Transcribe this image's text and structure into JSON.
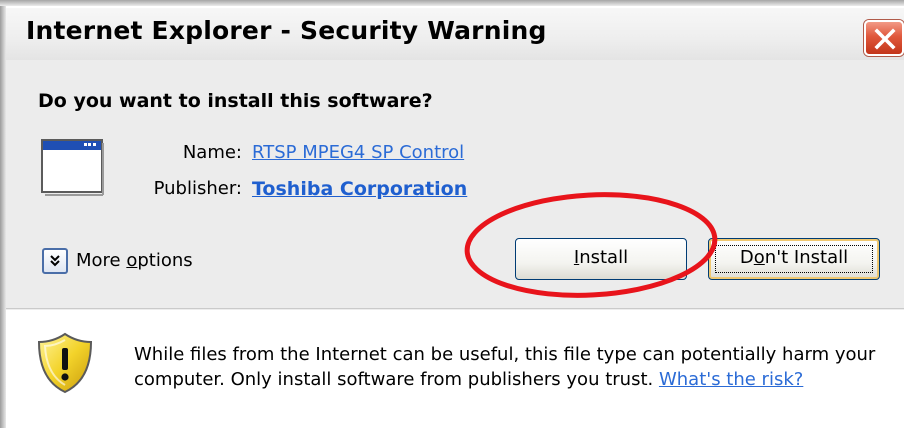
{
  "window": {
    "title": "Internet Explorer - Security Warning",
    "close_icon": "close-x-icon"
  },
  "prompt": {
    "question": "Do you want to install this software?",
    "app_icon": "application-window-icon",
    "name_label": "Name:",
    "name_value": "RTSP MPEG4 SP Control",
    "publisher_label": "Publisher:",
    "publisher_value": "Toshiba Corporation"
  },
  "options": {
    "more_options_prefix": "More ",
    "more_options_accel": "o",
    "more_options_suffix": "ptions",
    "toggle_icon": "chevron-double-down-icon"
  },
  "buttons": {
    "install_accel": "I",
    "install_rest": "nstall",
    "dont_install_prefix": "D",
    "dont_install_accel": "o",
    "dont_install_rest": "n't Install"
  },
  "warning": {
    "icon": "warning-shield-icon",
    "text": "While files from the Internet can be useful, this file type can potentially harm your computer. Only install software from publishers you trust. ",
    "risk_link": "What's the risk?"
  },
  "colors": {
    "link": "#2b6bd6",
    "annotation_circle": "#e8141b",
    "close_button": "#d9472b",
    "dialog_background": "#ececec"
  }
}
